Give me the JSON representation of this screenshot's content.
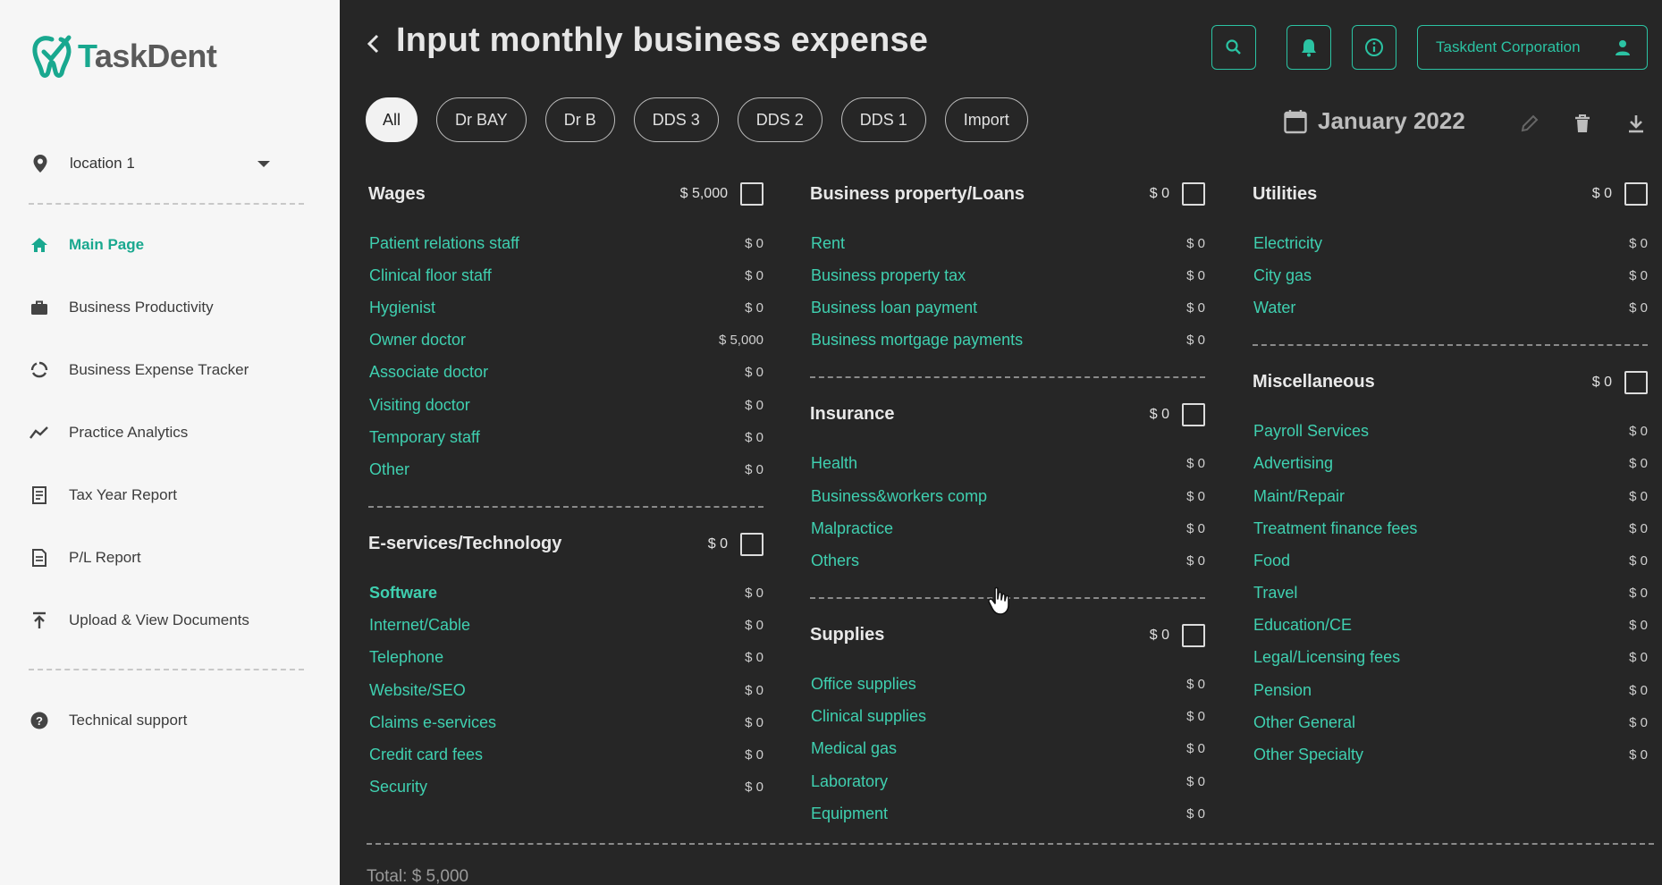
{
  "app": {
    "logo_prefix": "T",
    "logo_rest": "askDent",
    "brand_color": "#19a88f",
    "accent_color": "#2bc3a3"
  },
  "sidebar": {
    "location": "location 1",
    "nav": [
      {
        "label": "Main Page",
        "icon": "home-icon",
        "active": true
      },
      {
        "label": "Business Productivity",
        "icon": "briefcase-icon"
      },
      {
        "label": "Business Expense Tracker",
        "icon": "cycle-icon"
      },
      {
        "label": "Practice Analytics",
        "icon": "trend-icon"
      },
      {
        "label": "Tax Year Report",
        "icon": "receipt-icon"
      },
      {
        "label": "P/L Report",
        "icon": "document-icon"
      },
      {
        "label": "Upload & View Documents",
        "icon": "upload-icon"
      }
    ],
    "support": "Technical support"
  },
  "header": {
    "title": "Input monthly business expense",
    "corporation": "Taskdent Corporation"
  },
  "filters": [
    "All",
    "Dr BAY",
    "Dr B",
    "DDS 3",
    "DDS 2",
    "DDS 1",
    "Import"
  ],
  "month": "January 2022",
  "columns": [
    [
      {
        "title": "Wages",
        "amount": "$ 5,000",
        "items": [
          {
            "name": "Patient relations staff",
            "value": "$ 0"
          },
          {
            "name": "Clinical floor staff",
            "value": "$ 0"
          },
          {
            "name": "Hygienist",
            "value": "$ 0"
          },
          {
            "name": "Owner doctor",
            "value": "$ 5,000"
          },
          {
            "name": "Associate doctor",
            "value": "$ 0"
          },
          {
            "name": "Visiting doctor",
            "value": "$ 0"
          },
          {
            "name": "Temporary staff",
            "value": "$ 0"
          },
          {
            "name": "Other",
            "value": "$ 0"
          }
        ]
      },
      {
        "title": "E-services/Technology",
        "amount": "$ 0",
        "items": [
          {
            "name": "Software",
            "value": "$ 0",
            "hover": true
          },
          {
            "name": "Internet/Cable",
            "value": "$ 0"
          },
          {
            "name": "Telephone",
            "value": "$ 0"
          },
          {
            "name": "Website/SEO",
            "value": "$ 0"
          },
          {
            "name": "Claims e-services",
            "value": "$ 0"
          },
          {
            "name": "Credit card fees",
            "value": "$ 0"
          },
          {
            "name": "Security",
            "value": "$ 0"
          }
        ]
      }
    ],
    [
      {
        "title": "Business property/Loans",
        "amount": "$ 0",
        "items": [
          {
            "name": "Rent",
            "value": "$ 0"
          },
          {
            "name": "Business property tax",
            "value": "$ 0"
          },
          {
            "name": "Business loan payment",
            "value": "$ 0"
          },
          {
            "name": "Business mortgage payments",
            "value": "$ 0"
          }
        ]
      },
      {
        "title": "Insurance",
        "amount": "$ 0",
        "items": [
          {
            "name": "Health",
            "value": "$ 0"
          },
          {
            "name": "Business&workers comp",
            "value": "$ 0"
          },
          {
            "name": "Malpractice",
            "value": "$ 0"
          },
          {
            "name": "Others",
            "value": "$ 0"
          }
        ]
      },
      {
        "title": "Supplies",
        "amount": "$ 0",
        "items": [
          {
            "name": "Office supplies",
            "value": "$ 0"
          },
          {
            "name": "Clinical supplies",
            "value": "$ 0"
          },
          {
            "name": "Medical gas",
            "value": "$ 0"
          },
          {
            "name": "Laboratory",
            "value": "$ 0"
          },
          {
            "name": "Equipment",
            "value": "$ 0"
          }
        ]
      }
    ],
    [
      {
        "title": "Utilities",
        "amount": "$ 0",
        "items": [
          {
            "name": "Electricity",
            "value": "$ 0"
          },
          {
            "name": "City gas",
            "value": "$ 0"
          },
          {
            "name": "Water",
            "value": "$ 0"
          }
        ]
      },
      {
        "title": "Miscellaneous",
        "amount": "$ 0",
        "items": [
          {
            "name": "Payroll Services",
            "value": "$ 0"
          },
          {
            "name": "Advertising",
            "value": "$ 0"
          },
          {
            "name": "Maint/Repair",
            "value": "$ 0"
          },
          {
            "name": "Treatment finance fees",
            "value": "$ 0"
          },
          {
            "name": "Food",
            "value": "$ 0"
          },
          {
            "name": "Travel",
            "value": "$ 0"
          },
          {
            "name": "Education/CE",
            "value": "$ 0"
          },
          {
            "name": "Legal/Licensing fees",
            "value": "$ 0"
          },
          {
            "name": "Pension",
            "value": "$ 0"
          },
          {
            "name": "Other General",
            "value": "$ 0"
          },
          {
            "name": "Other Specialty",
            "value": "$ 0"
          }
        ]
      }
    ]
  ],
  "total": "Total: $ 5,000"
}
